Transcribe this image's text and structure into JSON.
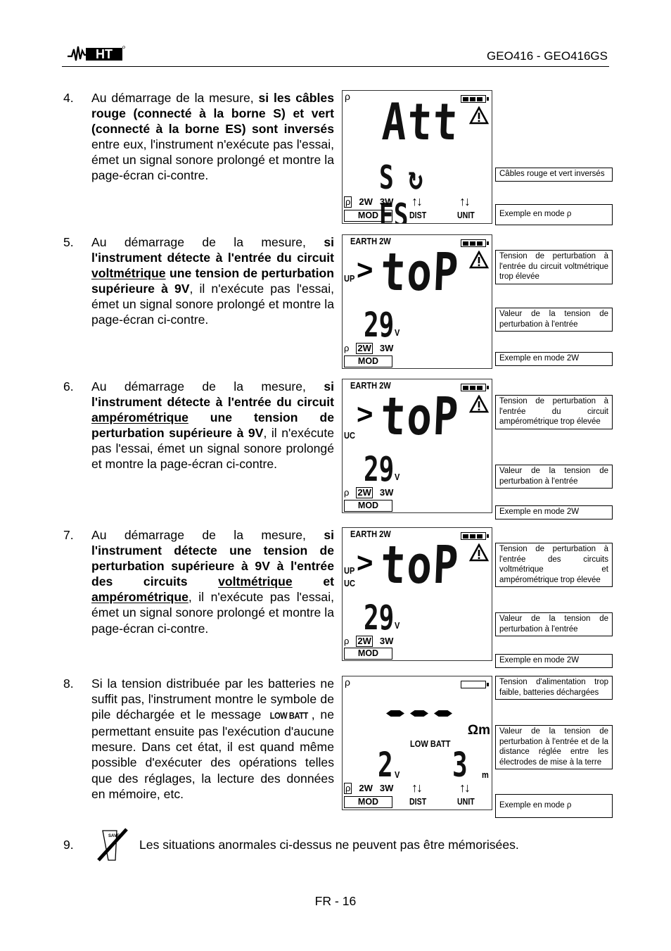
{
  "header": {
    "logo_text": "HT",
    "model": "GEO416 - GEO416GS"
  },
  "items": [
    {
      "number": "4.",
      "parts": [
        {
          "t": "Au démarrage de la mesure, ",
          "b": false
        },
        {
          "t": "si les câbles rouge (connecté à la borne S) et vert (connecté à la borne ES) sont inversés",
          "b": true
        },
        {
          "t": " entre eux, l'instrument n'exécute pas l'essai, émet un signal sonore prolongé et montre la page-écran ci-contre.",
          "b": false
        }
      ],
      "lcd": {
        "top_left": "ρ",
        "battery_cells": 3,
        "warning": true,
        "main": "Att",
        "secondary": "S ↻ ES",
        "modes": [
          "ρ",
          "2W",
          "3W"
        ],
        "selected_mode": "ρ",
        "keys": [
          "MOD",
          "DIST",
          "UNIT"
        ]
      },
      "callouts": [
        "Câbles rouge et vert inversés",
        "Exemple en mode ρ"
      ]
    },
    {
      "number": "5.",
      "parts": [
        {
          "t": "Au démarrage de la mesure, ",
          "b": false
        },
        {
          "t": "si l'instrument détecte à l'entrée du circuit ",
          "b": true
        },
        {
          "t": "voltmétrique",
          "b": true,
          "u": true
        },
        {
          "t": " une tension de perturbation supérieure à 9V",
          "b": true
        },
        {
          "t": ", il n'exécute pas l'essai, émet un signal sonore prolongé et montre la page-écran ci-contre.",
          "b": false
        }
      ],
      "lcd": {
        "top_left": "EARTH 2W",
        "battery_cells": 3,
        "warning": true,
        "side_labels": [
          "UP"
        ],
        "prefix": ">",
        "main": "toP",
        "value": "29",
        "value_unit": "V",
        "modes": [
          "ρ",
          "2W",
          "3W"
        ],
        "selected_mode": "2W",
        "keys": [
          "MOD"
        ]
      },
      "callouts": [
        "Tension de perturbation à l'entrée du circuit voltmétrique trop élevée",
        "Valeur de la tension de perturbation à l'entrée",
        "Exemple en mode 2W"
      ]
    },
    {
      "number": "6.",
      "parts": [
        {
          "t": "Au démarrage de la mesure, ",
          "b": false
        },
        {
          "t": "si l'instrument détecte à l'entrée du circuit ",
          "b": true
        },
        {
          "t": "ampérométrique",
          "b": true,
          "u": true
        },
        {
          "t": " une tension de perturbation supérieure à 9V",
          "b": true
        },
        {
          "t": ", il n'exécute pas l'essai, émet un signal sonore prolongé et montre la page-écran ci-contre.",
          "b": false
        }
      ],
      "lcd": {
        "top_left": "EARTH 2W",
        "battery_cells": 3,
        "warning": true,
        "side_labels": [
          "UC"
        ],
        "prefix": ">",
        "main": "toP",
        "value": "29",
        "value_unit": "V",
        "modes": [
          "ρ",
          "2W",
          "3W"
        ],
        "selected_mode": "2W",
        "keys": [
          "MOD"
        ]
      },
      "callouts": [
        "Tension de perturbation à l'entrée du circuit ampérométrique trop élevée",
        "Valeur de la tension de perturbation à l'entrée",
        "Exemple en mode 2W"
      ]
    },
    {
      "number": "7.",
      "parts": [
        {
          "t": "Au démarrage de la mesure, ",
          "b": false
        },
        {
          "t": "si l'instrument détecte une tension de perturbation supérieure à 9V à l'entrée des circuits ",
          "b": true
        },
        {
          "t": "voltmétrique",
          "b": true,
          "u": true
        },
        {
          "t": " et ",
          "b": true
        },
        {
          "t": "ampérométrique",
          "b": true,
          "u": true
        },
        {
          "t": ", il n'exécute pas l'essai, émet un signal sonore prolongé et montre la page-écran ci-contre.",
          "b": false
        }
      ],
      "lcd": {
        "top_left": "EARTH 2W",
        "battery_cells": 3,
        "warning": true,
        "side_labels": [
          "UP",
          "UC"
        ],
        "prefix": ">",
        "main": "toP",
        "value": "29",
        "value_unit": "V",
        "modes": [
          "ρ",
          "2W",
          "3W"
        ],
        "selected_mode": "2W",
        "keys": [
          "MOD"
        ]
      },
      "callouts": [
        "Tension de perturbation à l'entrée des circuits voltmétrique et ampérométrique trop élevée",
        "Valeur de la tension de perturbation à l'entrée",
        "Exemple en mode 2W"
      ]
    },
    {
      "number": "8.",
      "parts": [
        {
          "t": "Si la tension distribuée par les batteries ne suffit pas, l'instrument montre le symbole de pile déchargée et le message ",
          "b": false
        },
        {
          "t": "LOW BATT",
          "lowbatt": true
        },
        {
          "t": ", ne permettant ensuite pas l'exécution d'aucune mesure. Dans cet état, il est quand même possible d'exécuter des opérations telles que des réglages, la lecture des données en mémoire, etc.",
          "b": false
        }
      ],
      "lcd": {
        "top_left": "ρ",
        "battery_cells": 0,
        "warning": false,
        "main": "---",
        "main_unit": "Ωm",
        "status": "LOW BATT",
        "value": "2",
        "value_unit": "V",
        "distance": "3",
        "distance_unit": "m",
        "modes": [
          "ρ",
          "2W",
          "3W"
        ],
        "selected_mode": "ρ",
        "keys": [
          "MOD",
          "DIST",
          "UNIT"
        ]
      },
      "callouts": [
        "Tension d'alimentation trop faible, batteries déchargées",
        "Valeur de la tension de perturbation à l'entrée et de la distance réglée entre les électrodes de mise à la terre",
        "Exemple en mode ρ"
      ]
    }
  ],
  "item9": {
    "number": "9.",
    "icon_label": "SAVE",
    "text": "Les situations anormales ci-dessus ne peuvent pas être mémorisées."
  },
  "footer": {
    "page": "FR - 16"
  }
}
